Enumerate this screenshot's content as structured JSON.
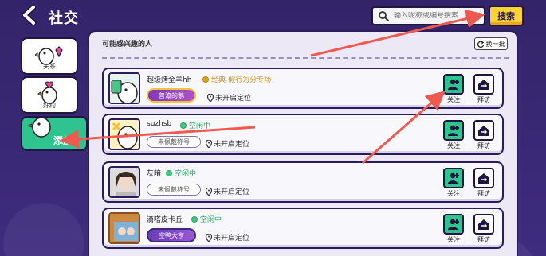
{
  "header": {
    "title": "社交",
    "search_placeholder": "输入昵称或编号搜索",
    "search_button": "搜索"
  },
  "sidebar": {
    "items": [
      {
        "label": "关系"
      },
      {
        "label": "好约"
      },
      {
        "label": "添加"
      }
    ]
  },
  "main": {
    "section_title": "可能感兴趣的人",
    "refresh_label": "换一批",
    "follow_label": "关注",
    "visit_label": "拜访",
    "rows": [
      {
        "name": "超级烤全羊hh",
        "status": "经典-假行为分专场",
        "status_color": "#e2a51b",
        "badge": "普漆的鹅",
        "location": "未开启定位"
      },
      {
        "name": "suzhsb",
        "status": "空闲中",
        "status_color": "#3ec97d",
        "badge": "未佩戴称号",
        "location": "未开启定位"
      },
      {
        "name": "灰暗",
        "status": "空闲中",
        "status_color": "#3ec97d",
        "badge": "未佩戴称号",
        "location": "未开启定位"
      },
      {
        "name": "滴嗒皮卡丘",
        "status": "空闲中",
        "status_color": "#3ec97d",
        "badge": "空鸭大亨",
        "location": "未开启定位"
      }
    ]
  },
  "colors": {
    "accent_green": "#2fc38f",
    "search_yellow": "#ffd23a",
    "annotation_red": "#ee5a4f"
  }
}
